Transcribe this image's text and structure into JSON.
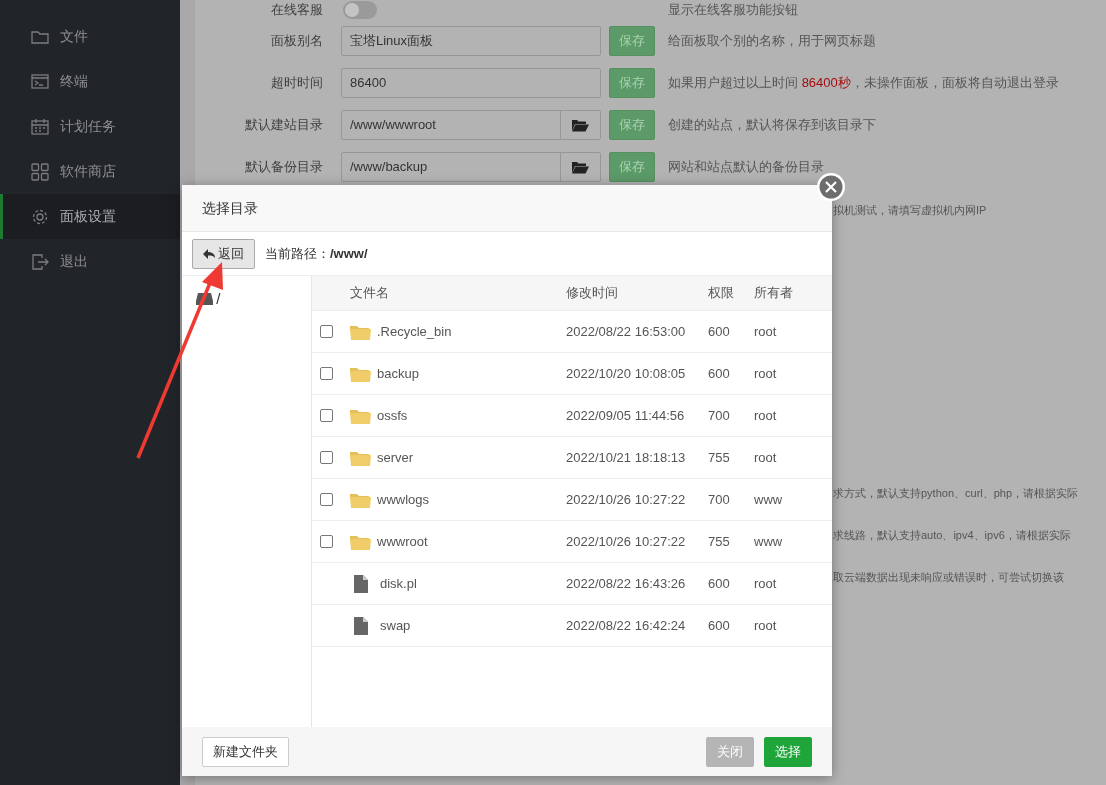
{
  "sidebar": {
    "items": [
      {
        "label": "文件",
        "selected": false
      },
      {
        "label": "终端",
        "selected": false
      },
      {
        "label": "计划任务",
        "selected": false
      },
      {
        "label": "软件商店",
        "selected": false
      },
      {
        "label": "面板设置",
        "selected": true
      },
      {
        "label": "退出",
        "selected": false
      }
    ]
  },
  "settings": [
    {
      "kind": "toggle",
      "label": "在线客服",
      "on": false,
      "description": [
        {
          "text": "显示在线客服功能按钮",
          "emphasis": false
        }
      ]
    },
    {
      "kind": "text",
      "label": "面板别名",
      "value": "宝塔Linux面板",
      "button": "保存",
      "description": [
        {
          "text": "给面板取个别的名称，用于网页标题",
          "emphasis": false
        }
      ]
    },
    {
      "kind": "text",
      "label": "超时时间",
      "value": "86400",
      "button": "保存",
      "description": [
        {
          "text": "如果用户超过以上时间 ",
          "emphasis": false
        },
        {
          "text": "86400秒",
          "emphasis": true
        },
        {
          "text": "，未操作面板，面板将自动退出登录",
          "emphasis": false
        }
      ]
    },
    {
      "kind": "path",
      "label": "默认建站目录",
      "value": "/www/wwwroot",
      "button": "保存",
      "description": [
        {
          "text": "创建的站点，默认将保存到该目录下",
          "emphasis": false
        }
      ]
    },
    {
      "kind": "path",
      "label": "默认备份目录",
      "value": "/www/backup",
      "button": "保存",
      "description": [
        {
          "text": "网站和站点默认的备份目录",
          "emphasis": false
        }
      ]
    }
  ],
  "partial_notes": [
    {
      "text": "拟机测试，请填写虚拟机内网IP"
    },
    {
      "text": "求方式，默认支持python、curl、php，请根据实际"
    },
    {
      "text": "求线路，默认支持auto、ipv4、ipv6，请根据实际"
    },
    {
      "text": "取云端数据出现未响应或错误时，可尝试切换该"
    }
  ],
  "dialog": {
    "title": "选择目录",
    "back_button": "返回",
    "path_label": "当前路径：",
    "path": "/www/",
    "tree": [
      {
        "label": "/"
      }
    ],
    "columns": [
      "文件名",
      "修改时间",
      "权限",
      "所有者"
    ],
    "rows": [
      {
        "kind": "folder",
        "checked": false,
        "name": ".Recycle_bin",
        "modified": "2022/08/22 16:53:00",
        "permission": "600",
        "owner": "root"
      },
      {
        "kind": "folder",
        "checked": false,
        "name": "backup",
        "modified": "2022/10/20 10:08:05",
        "permission": "600",
        "owner": "root"
      },
      {
        "kind": "folder",
        "checked": false,
        "name": "ossfs",
        "modified": "2022/09/05 11:44:56",
        "permission": "700",
        "owner": "root"
      },
      {
        "kind": "folder",
        "checked": false,
        "name": "server",
        "modified": "2022/10/21 18:18:13",
        "permission": "755",
        "owner": "root"
      },
      {
        "kind": "folder",
        "checked": false,
        "name": "wwwlogs",
        "modified": "2022/10/26 10:27:22",
        "permission": "700",
        "owner": "www"
      },
      {
        "kind": "folder",
        "checked": false,
        "name": "wwwroot",
        "modified": "2022/10/26 10:27:22",
        "permission": "755",
        "owner": "www"
      },
      {
        "kind": "file",
        "name": "disk.pl",
        "modified": "2022/08/22 16:43:26",
        "permission": "600",
        "owner": "root"
      },
      {
        "kind": "file",
        "name": "swap",
        "modified": "2022/08/22 16:42:24",
        "permission": "600",
        "owner": "root"
      }
    ],
    "buttons": [
      {
        "kind": "secondary",
        "label": "新建文件夹",
        "disabled": false
      },
      {
        "kind": "cancel",
        "label": "关闭",
        "disabled": true
      },
      {
        "kind": "primary",
        "label": "选择",
        "disabled": false
      }
    ]
  }
}
